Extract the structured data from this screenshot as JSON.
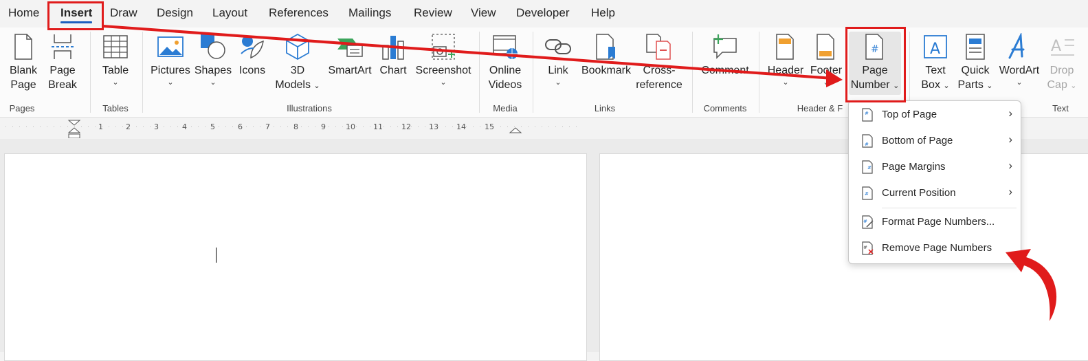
{
  "tabs": [
    "Home",
    "Insert",
    "Draw",
    "Design",
    "Layout",
    "References",
    "Mailings",
    "Review",
    "View",
    "Developer",
    "Help"
  ],
  "active_tab": "Insert",
  "ribbon": {
    "blank_page": [
      "Blank",
      "Page"
    ],
    "page_break": [
      "Page",
      "Break"
    ],
    "table": "Table",
    "pictures": "Pictures",
    "shapes": "Shapes",
    "icons": "Icons",
    "models_3d": [
      "3D",
      "Models"
    ],
    "smartart": "SmartArt",
    "chart": "Chart",
    "screenshot": "Screenshot",
    "online_videos": [
      "Online",
      "Videos"
    ],
    "link": "Link",
    "bookmark": "Bookmark",
    "cross_reference": [
      "Cross-",
      "reference"
    ],
    "comment": "Comment",
    "header": "Header",
    "footer": "Footer",
    "page_number": [
      "Page",
      "Number"
    ],
    "text_box": [
      "Text",
      "Box"
    ],
    "quick_parts": [
      "Quick",
      "Parts"
    ],
    "wordart": "WordArt",
    "drop_cap": [
      "Drop",
      "Cap"
    ]
  },
  "groups": {
    "pages": "Pages",
    "tables": "Tables",
    "illustrations": "Illustrations",
    "media": "Media",
    "links": "Links",
    "comments": "Comments",
    "header_footer": "Header & F",
    "text": "Text"
  },
  "ruler_numbers": [
    "1",
    "2",
    "3",
    "4",
    "5",
    "6",
    "7",
    "8",
    "9",
    "10",
    "11",
    "12",
    "13",
    "14",
    "15"
  ],
  "page_number_menu": {
    "items": [
      {
        "label": "Top of Page",
        "has_submenu": true
      },
      {
        "label": "Bottom of Page",
        "has_submenu": true
      },
      {
        "label": "Page Margins",
        "has_submenu": true
      },
      {
        "label": "Current Position",
        "has_submenu": true
      },
      {
        "label": "Format Page Numbers...",
        "has_submenu": false
      },
      {
        "label": "Remove Page Numbers",
        "has_submenu": false
      }
    ]
  },
  "colors": {
    "accent_blue": "#1b5ebe",
    "annotation_red": "#e01b1b",
    "icon_blue": "#2b7cd3",
    "icon_green": "#3ca55c"
  }
}
